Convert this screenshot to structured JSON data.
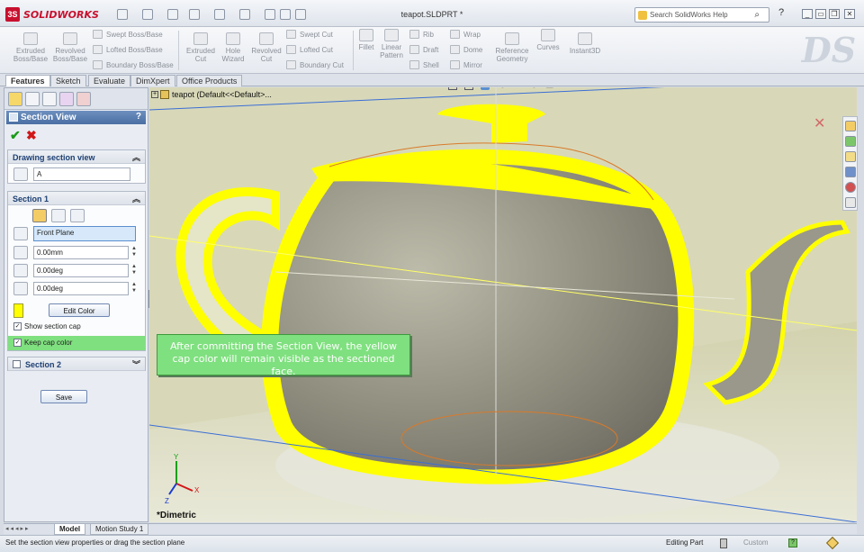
{
  "app": {
    "name": "SOLIDWORKS",
    "doc_title": "teapot.SLDPRT *"
  },
  "search": {
    "placeholder": "Search SolidWorks Help"
  },
  "commands": {
    "extruded_boss": [
      "Extruded",
      "Boss/Base"
    ],
    "revolved_boss": [
      "Revolved",
      "Boss/Base"
    ],
    "swept_boss": "Swept Boss/Base",
    "lofted_boss": "Lofted Boss/Base",
    "boundary_boss": "Boundary Boss/Base",
    "extruded_cut": [
      "Extruded",
      "Cut"
    ],
    "hole_wizard": [
      "Hole",
      "Wizard"
    ],
    "revolved_cut": [
      "Revolved",
      "Cut"
    ],
    "swept_cut": "Swept Cut",
    "lofted_cut": "Lofted Cut",
    "boundary_cut": "Boundary Cut",
    "fillet": "Fillet",
    "linear_pattern": [
      "Linear",
      "Pattern"
    ],
    "rib": "Rib",
    "draft": "Draft",
    "shell": "Shell",
    "wrap": "Wrap",
    "dome": "Dome",
    "mirror": "Mirror",
    "reference_geometry": [
      "Reference",
      "Geometry"
    ],
    "curves": "Curves",
    "instant3d": "Instant3D"
  },
  "tabs": [
    "Features",
    "Sketch",
    "Evaluate",
    "DimXpert",
    "Office Products"
  ],
  "panel": {
    "title": "Section View",
    "help": "?",
    "drawing_section": {
      "header": "Drawing section view",
      "value": "A"
    },
    "section1": {
      "header": "Section 1",
      "plane": "Front Plane",
      "offset": "0.00mm",
      "angle_x": "0.00deg",
      "angle_y": "0.00deg",
      "edit_color": "Edit Color",
      "show_cap": "Show section cap",
      "keep_cap_color": "Keep cap color"
    },
    "section2": {
      "header": "Section 2"
    },
    "save": "Save"
  },
  "viewport": {
    "tree_label": "teapot  (Default<<Default>...",
    "view_name": "*Dimetric"
  },
  "callout": "After committing the Section View, the yellow cap color will remain visible as the sectioned face.",
  "bottom_tabs": [
    "Model",
    "Motion Study 1"
  ],
  "status": {
    "message": "Set the section view properties or drag the section plane",
    "mode": "Editing Part",
    "config": "Custom"
  },
  "colors": {
    "cap": "#ffff00",
    "callout": "#7fe07f",
    "accent": "#4b6fa3"
  }
}
